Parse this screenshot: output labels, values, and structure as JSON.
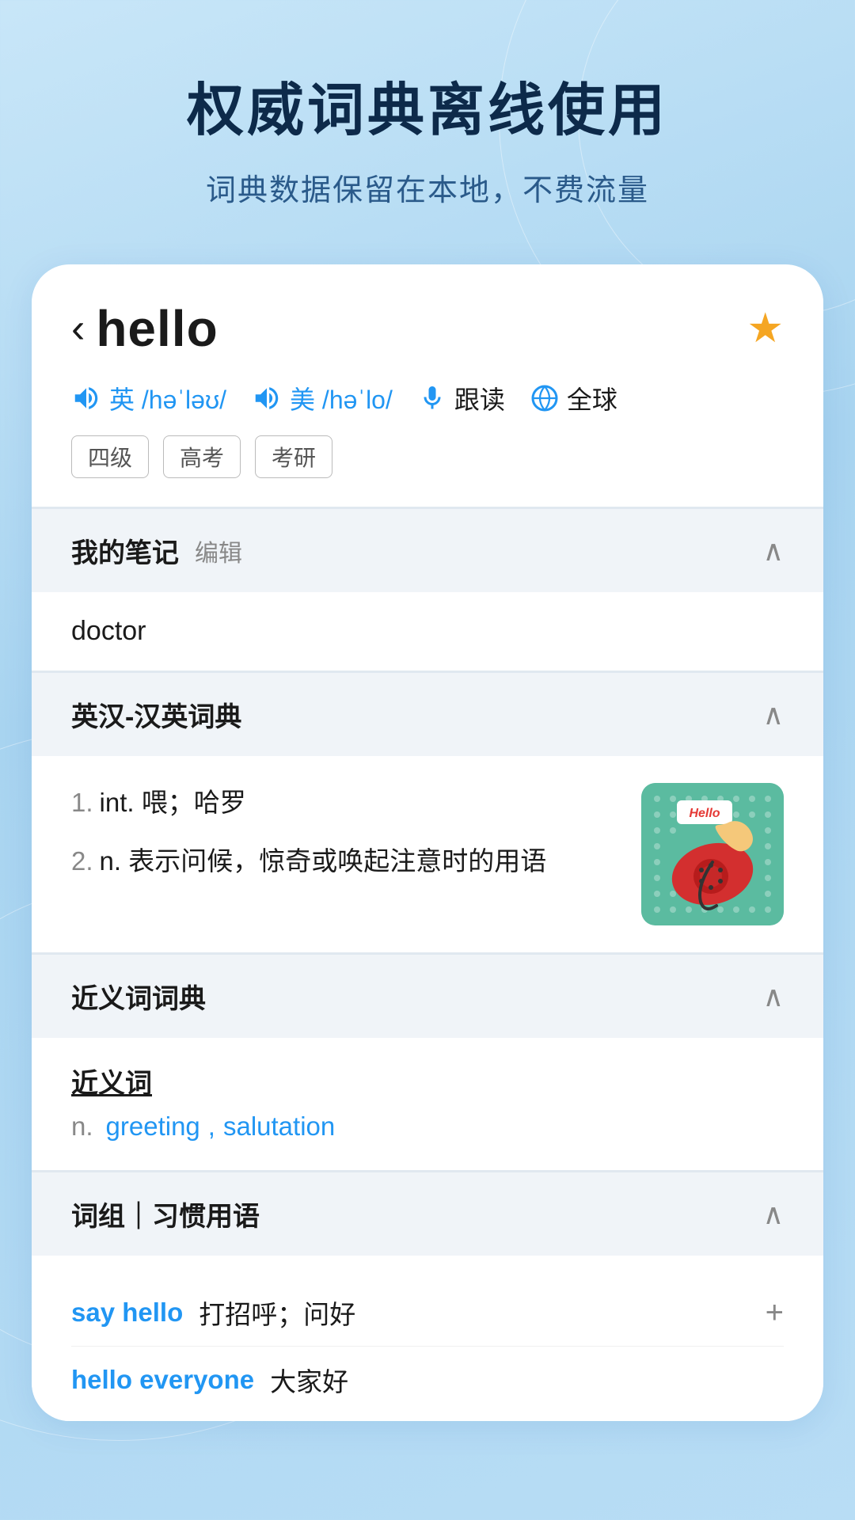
{
  "hero": {
    "title": "权威词典离线使用",
    "subtitle": "词典数据保留在本地，不费流量"
  },
  "word": {
    "back_label": "‹",
    "word": "hello",
    "star": "★",
    "phonetics": [
      {
        "region": "英",
        "ipa": "/həˈləʊ/"
      },
      {
        "region": "美",
        "ipa": "/həˈlo/"
      }
    ],
    "actions": [
      {
        "label": "跟读"
      },
      {
        "label": "全球"
      }
    ],
    "tags": [
      "四级",
      "高考",
      "考研"
    ]
  },
  "sections": {
    "notes": {
      "title": "我的笔记",
      "edit_label": "编辑",
      "content": "doctor"
    },
    "dict": {
      "title": "英汉-汉英词典",
      "entries": [
        {
          "num": "1.",
          "text": "int. 喂；哈罗"
        },
        {
          "num": "2.",
          "text": "n. 表示问候，惊奇或唤起注意时的用语"
        }
      ],
      "image_label": "Hello"
    },
    "synonyms": {
      "title": "近义词词典",
      "section_label": "近义词",
      "pos": "n.",
      "words": [
        "greeting",
        "salutation"
      ]
    },
    "phrases": {
      "title": "词组｜习惯用语",
      "items": [
        {
          "en": "say hello",
          "zh": "打招呼；问好"
        },
        {
          "en": "hello everyone",
          "zh": "大家好"
        }
      ]
    }
  }
}
